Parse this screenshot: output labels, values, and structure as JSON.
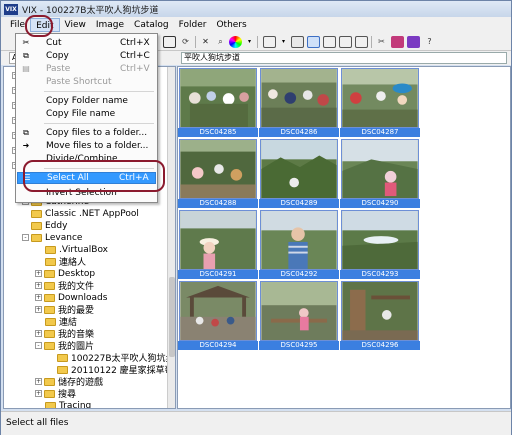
{
  "window": {
    "title": "VIX - 100227B太平吹人狗坑步道"
  },
  "menubar": [
    "File",
    "Edit",
    "View",
    "Image",
    "Catalog",
    "Folder",
    "Others"
  ],
  "address": {
    "button_label": "Add",
    "path": "平吹人狗坑步道"
  },
  "edit_menu": {
    "items": [
      {
        "label": "Cut",
        "shortcut": "Ctrl+X",
        "icon": "cut-icon",
        "state": "partial"
      },
      {
        "label": "Copy",
        "shortcut": "Ctrl+C",
        "icon": "copy-icon",
        "state": "normal"
      },
      {
        "label": "Paste",
        "shortcut": "Ctrl+V",
        "icon": "paste-icon",
        "state": "disabled"
      },
      {
        "label": "Paste Shortcut",
        "shortcut": "",
        "icon": "",
        "state": "disabled"
      },
      {
        "label": "Copy Folder name",
        "shortcut": "",
        "icon": "",
        "state": "normal"
      },
      {
        "label": "Copy File name",
        "shortcut": "",
        "icon": "",
        "state": "normal"
      },
      {
        "label": "Copy files to a folder...",
        "shortcut": "",
        "icon": "copy-to-folder-icon",
        "state": "normal"
      },
      {
        "label": "Move files to a folder...",
        "shortcut": "",
        "icon": "move-to-folder-icon",
        "state": "normal"
      },
      {
        "label": "Divide/Combine",
        "shortcut": "",
        "icon": "",
        "state": "partial"
      },
      {
        "label": "Select All",
        "shortcut": "Ctrl+A",
        "icon": "select-all-icon",
        "state": "selected"
      },
      {
        "label": "Invert Selection",
        "shortcut": "",
        "icon": "",
        "state": "partial"
      }
    ]
  },
  "tree": {
    "items": [
      {
        "label": "Catherine",
        "indent": 0,
        "expander": "+"
      },
      {
        "label": "Classic .NET AppPool",
        "indent": 0,
        "expander": ""
      },
      {
        "label": "Eddy",
        "indent": 0,
        "expander": ""
      },
      {
        "label": "Levance",
        "indent": 0,
        "expander": "-"
      },
      {
        "label": ".VirtualBox",
        "indent": 1,
        "expander": ""
      },
      {
        "label": "連絡人",
        "indent": 1,
        "expander": ""
      },
      {
        "label": "Desktop",
        "indent": 1,
        "expander": "+"
      },
      {
        "label": "我的文件",
        "indent": 1,
        "expander": "+"
      },
      {
        "label": "Downloads",
        "indent": 1,
        "expander": "+"
      },
      {
        "label": "我的最愛",
        "indent": 1,
        "expander": "+"
      },
      {
        "label": "連結",
        "indent": 1,
        "expander": ""
      },
      {
        "label": "我的音樂",
        "indent": 1,
        "expander": "+"
      },
      {
        "label": "我的圖片",
        "indent": 1,
        "expander": "-"
      },
      {
        "label": "100227B太平吹人狗坑步道",
        "indent": 2,
        "expander": ""
      },
      {
        "label": "20110122 慶星家採草莓",
        "indent": 2,
        "expander": ""
      },
      {
        "label": "儲存的遊戲",
        "indent": 1,
        "expander": "+"
      },
      {
        "label": "搜尋",
        "indent": 1,
        "expander": "+"
      },
      {
        "label": "Tracing",
        "indent": 1,
        "expander": ""
      }
    ]
  },
  "thumbnails": [
    "DSC04285",
    "DSC04286",
    "DSC04287",
    "DSC04288",
    "DSC04289",
    "DSC04290",
    "DSC04291",
    "DSC04292",
    "DSC04293",
    "DSC04294",
    "DSC04295",
    "DSC04296"
  ],
  "status": {
    "text": "Select all files"
  },
  "colors": {
    "selection": "#3b7fe0",
    "annotation_ring": "#8b1a2e",
    "menu_highlight": "#3399ff"
  }
}
